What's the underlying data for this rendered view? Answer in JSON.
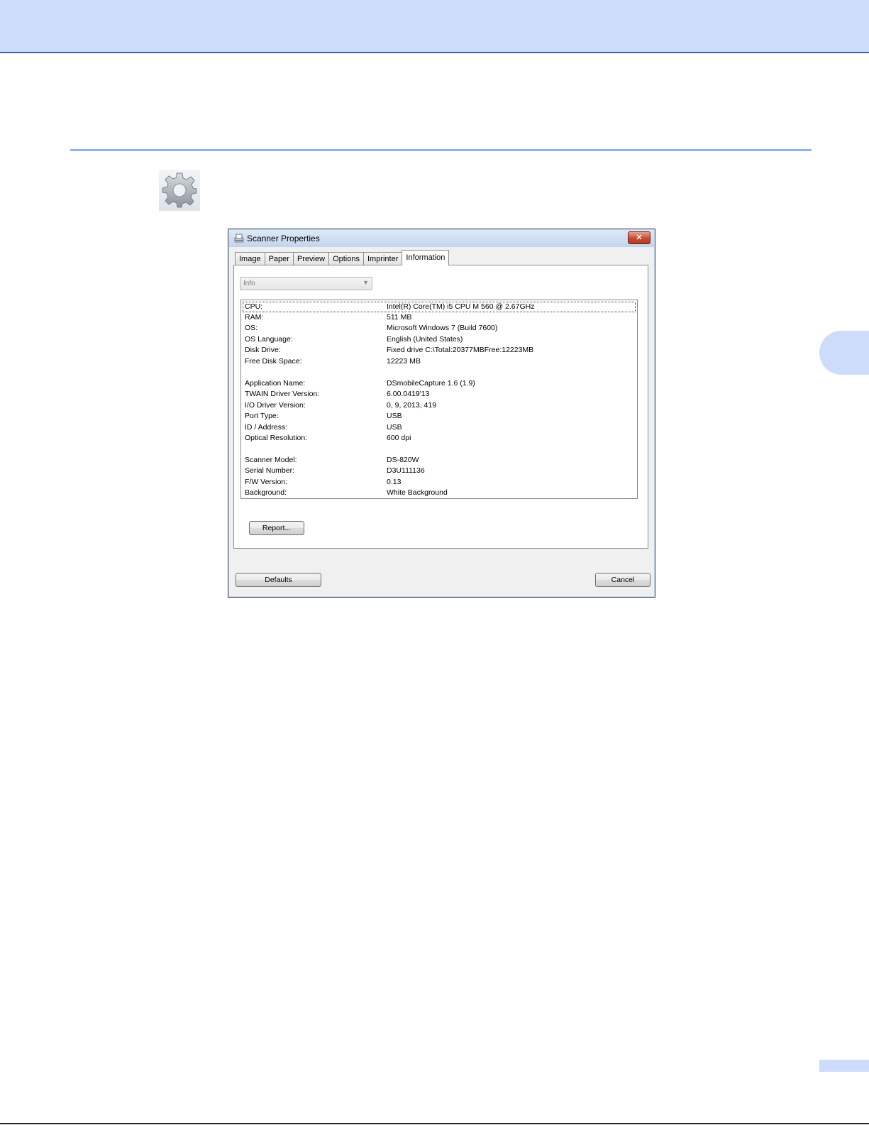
{
  "dialog": {
    "title": "Scanner Properties",
    "close_label": "✕",
    "tabs": [
      "Image",
      "Paper",
      "Preview",
      "Options",
      "Imprinter",
      "Information"
    ],
    "active_tab": "Information",
    "info_select": {
      "value": "Info"
    },
    "info_rows": [
      {
        "key": "CPU:",
        "value": "Intel(R) Core(TM) i5 CPU       M 560  @ 2.67GHz"
      },
      {
        "key": "RAM:",
        "value": "511 MB"
      },
      {
        "key": "OS:",
        "value": "Microsoft Windows 7  (Build 7600)"
      },
      {
        "key": "OS Language:",
        "value": "English (United States)"
      },
      {
        "key": "Disk Drive:",
        "value": "Fixed drive C:\\Total:20377MBFree:12223MB"
      },
      {
        "key": "Free Disk Space:",
        "value": "12223 MB"
      },
      {
        "key": "",
        "value": ""
      },
      {
        "key": "Application Name:",
        "value": " DSmobileCapture 1.6 (1.9)"
      },
      {
        "key": "TWAIN Driver Version:",
        "value": "6.00.0419'13"
      },
      {
        "key": "I/O Driver Version:",
        "value": "0, 9, 2013, 419"
      },
      {
        "key": "Port Type:",
        "value": "USB"
      },
      {
        "key": "ID / Address:",
        "value": "USB"
      },
      {
        "key": "Optical Resolution:",
        "value": "600 dpi"
      },
      {
        "key": "",
        "value": ""
      },
      {
        "key": "Scanner Model:",
        "value": "DS-820W"
      },
      {
        "key": "Serial Number:",
        "value": "D3U111136"
      },
      {
        "key": "F/W Version:",
        "value": "0.13"
      },
      {
        "key": "Background:",
        "value": "White Background"
      }
    ],
    "report_label": "Report...",
    "defaults_label": "Defaults",
    "cancel_label": "Cancel"
  },
  "icons": {
    "settings": "gear-icon",
    "scanner": "scanner-icon",
    "close": "close-icon",
    "dropdown": "chevron-down-icon"
  },
  "colors": {
    "banner": "#cddcfb",
    "banner_border": "#3a63b6",
    "rule": "#8fb0ef"
  }
}
